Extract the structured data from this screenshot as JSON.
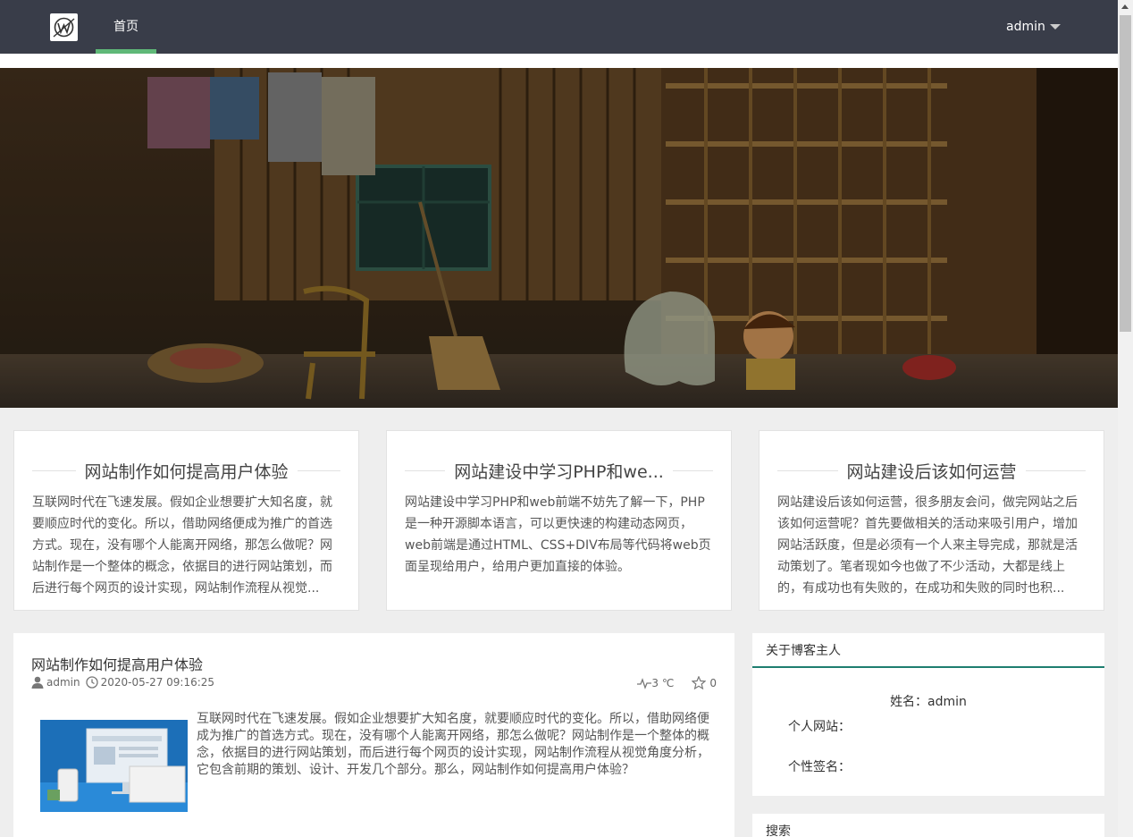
{
  "header": {
    "nav_home": "首页",
    "user_name": "admin"
  },
  "cards": [
    {
      "title": "网站制作如何提高用户体验",
      "text": "互联网时代在飞速发展。假如企业想要扩大知名度，就要顺应时代的变化。所以，借助网络便成为推广的首选方式。现在，没有哪个人能离开网络，那怎么做呢？网站制作是一个整体的概念，依据目的进行网站策划，而后进行每个网页的设计实现，网站制作流程从视觉..."
    },
    {
      "title": "网站建设中学习PHP和we...",
      "text": "网站建设中学习PHP和web前端不妨先了解一下，PHP是一种开源脚本语言，可以更快速的构建动态网页，web前端是通过HTML、CSS+DIV布局等代码将web页面呈现给用户，给用户更加直接的体验。"
    },
    {
      "title": "网站建设后该如何运营",
      "text": "网站建设后该如何运营，很多朋友会问，做完网站之后该如何运营呢？首先要做相关的活动来吸引用户，增加网站活跃度，但是必须有一个人来主导完成，那就是活动策划了。笔者现如今也做了不少活动，大都是线上的，有成功也有失败的，在成功和失败的同时也积..."
    }
  ],
  "article": {
    "title": "网站制作如何提高用户体验",
    "author": "admin",
    "datetime": "2020-05-27 09:16:25",
    "heat": "3 ℃",
    "likes": "0",
    "summary": "互联网时代在飞速发展。假如企业想要扩大知名度，就要顺应时代的变化。所以，借助网络便成为推广的首选方式。现在，没有哪个人能离开网络，那怎么做呢？网站制作是一个整体的概念，依据目的进行网站策划，而后进行每个网页的设计实现，网站制作流程从视觉角度分析，它包含前期的策划、设计、开发几个部分。那么，网站制作如何提高用户体验？"
  },
  "sidebar": {
    "about_title": "关于博客主人",
    "name_line": "姓名：admin",
    "website_label": "个人网站：",
    "signature_label": "个性签名：",
    "search_title": "搜索"
  },
  "colors": {
    "header_bg": "#393d49",
    "accent_green": "#5fb878",
    "sidebar_accent": "#1e7e70"
  }
}
